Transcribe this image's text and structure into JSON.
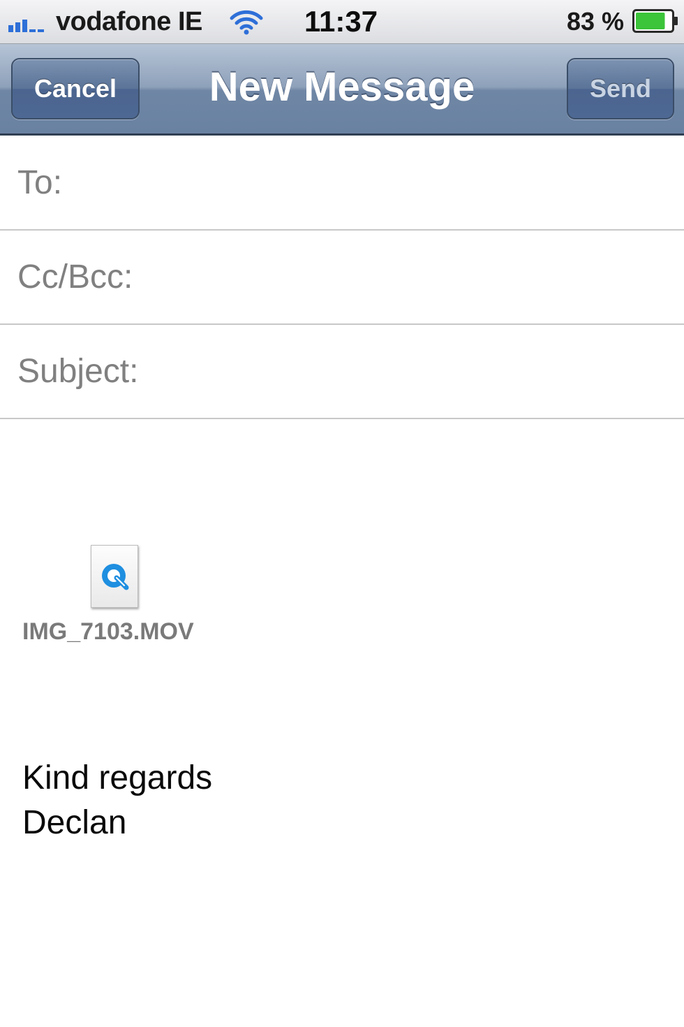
{
  "status_bar": {
    "carrier": "vodafone IE",
    "time": "11:37",
    "battery_percent": "83 %",
    "battery_level": 0.83,
    "signal_icon": "signal-bars-icon",
    "wifi_icon": "wifi-icon",
    "battery_icon": "battery-icon",
    "battery_color": "#3cc43a"
  },
  "nav": {
    "cancel_label": "Cancel",
    "title": "New Message",
    "send_label": "Send"
  },
  "fields": {
    "to_label": "To:",
    "cc_label": "Cc/Bcc:",
    "subject_label": "Subject:"
  },
  "body": {
    "attachment": {
      "icon": "quicktime-file-icon",
      "name": "IMG_7103.MOV"
    },
    "signature_line1": "Kind regards",
    "signature_line2": "Declan"
  }
}
